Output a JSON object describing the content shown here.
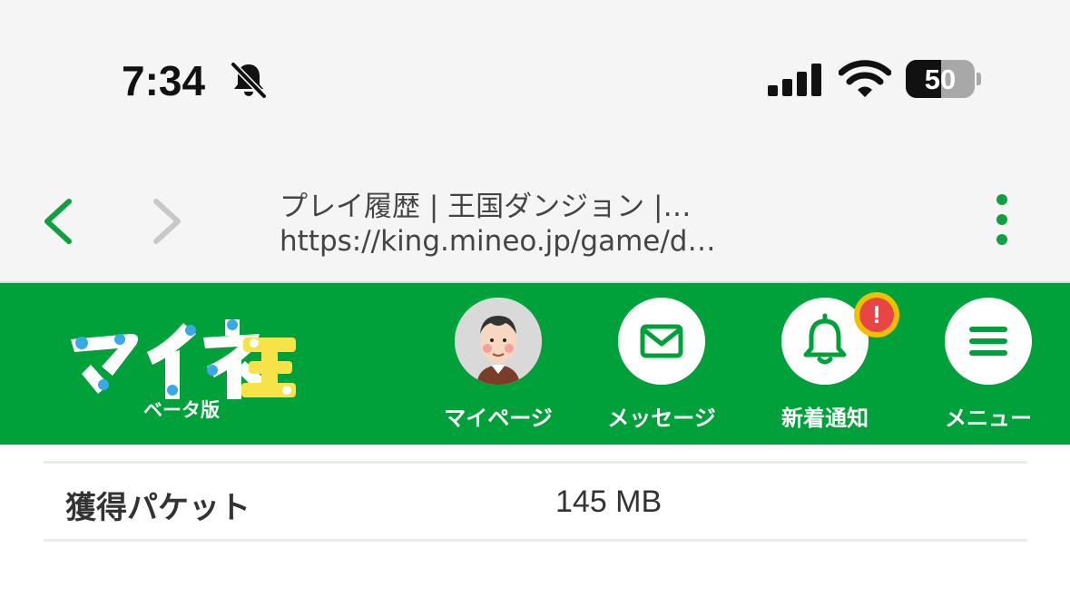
{
  "status_bar": {
    "time": "7:34",
    "battery_percent": "50",
    "battery_level": 0.5,
    "icons": [
      "bell-slash-icon",
      "cellular-signal-icon",
      "wifi-icon",
      "battery-icon"
    ]
  },
  "browser": {
    "title": "プレイ履歴 | 王国ダンジョン |…",
    "url": "https://king.mineo.jp/game/d…",
    "icons": [
      "chevron-left-icon",
      "chevron-right-icon",
      "kebab-menu-icon"
    ]
  },
  "header": {
    "logo_text": "マイネ王",
    "beta_label": "ベータ版",
    "nav": [
      {
        "label": "マイページ",
        "icon": "avatar"
      },
      {
        "label": "メッセージ",
        "icon": "envelope-icon"
      },
      {
        "label": "新着通知",
        "icon": "bell-icon",
        "badge": "!"
      },
      {
        "label": "メニュー",
        "icon": "hamburger-icon"
      }
    ]
  },
  "content": {
    "row_label": "獲得パケット",
    "row_value": "145 MB"
  },
  "colors": {
    "brand_green": "#00a13a",
    "nav_accent_green": "#00a13a",
    "alert_red": "#e84545",
    "alert_ring": "#f0c000"
  }
}
